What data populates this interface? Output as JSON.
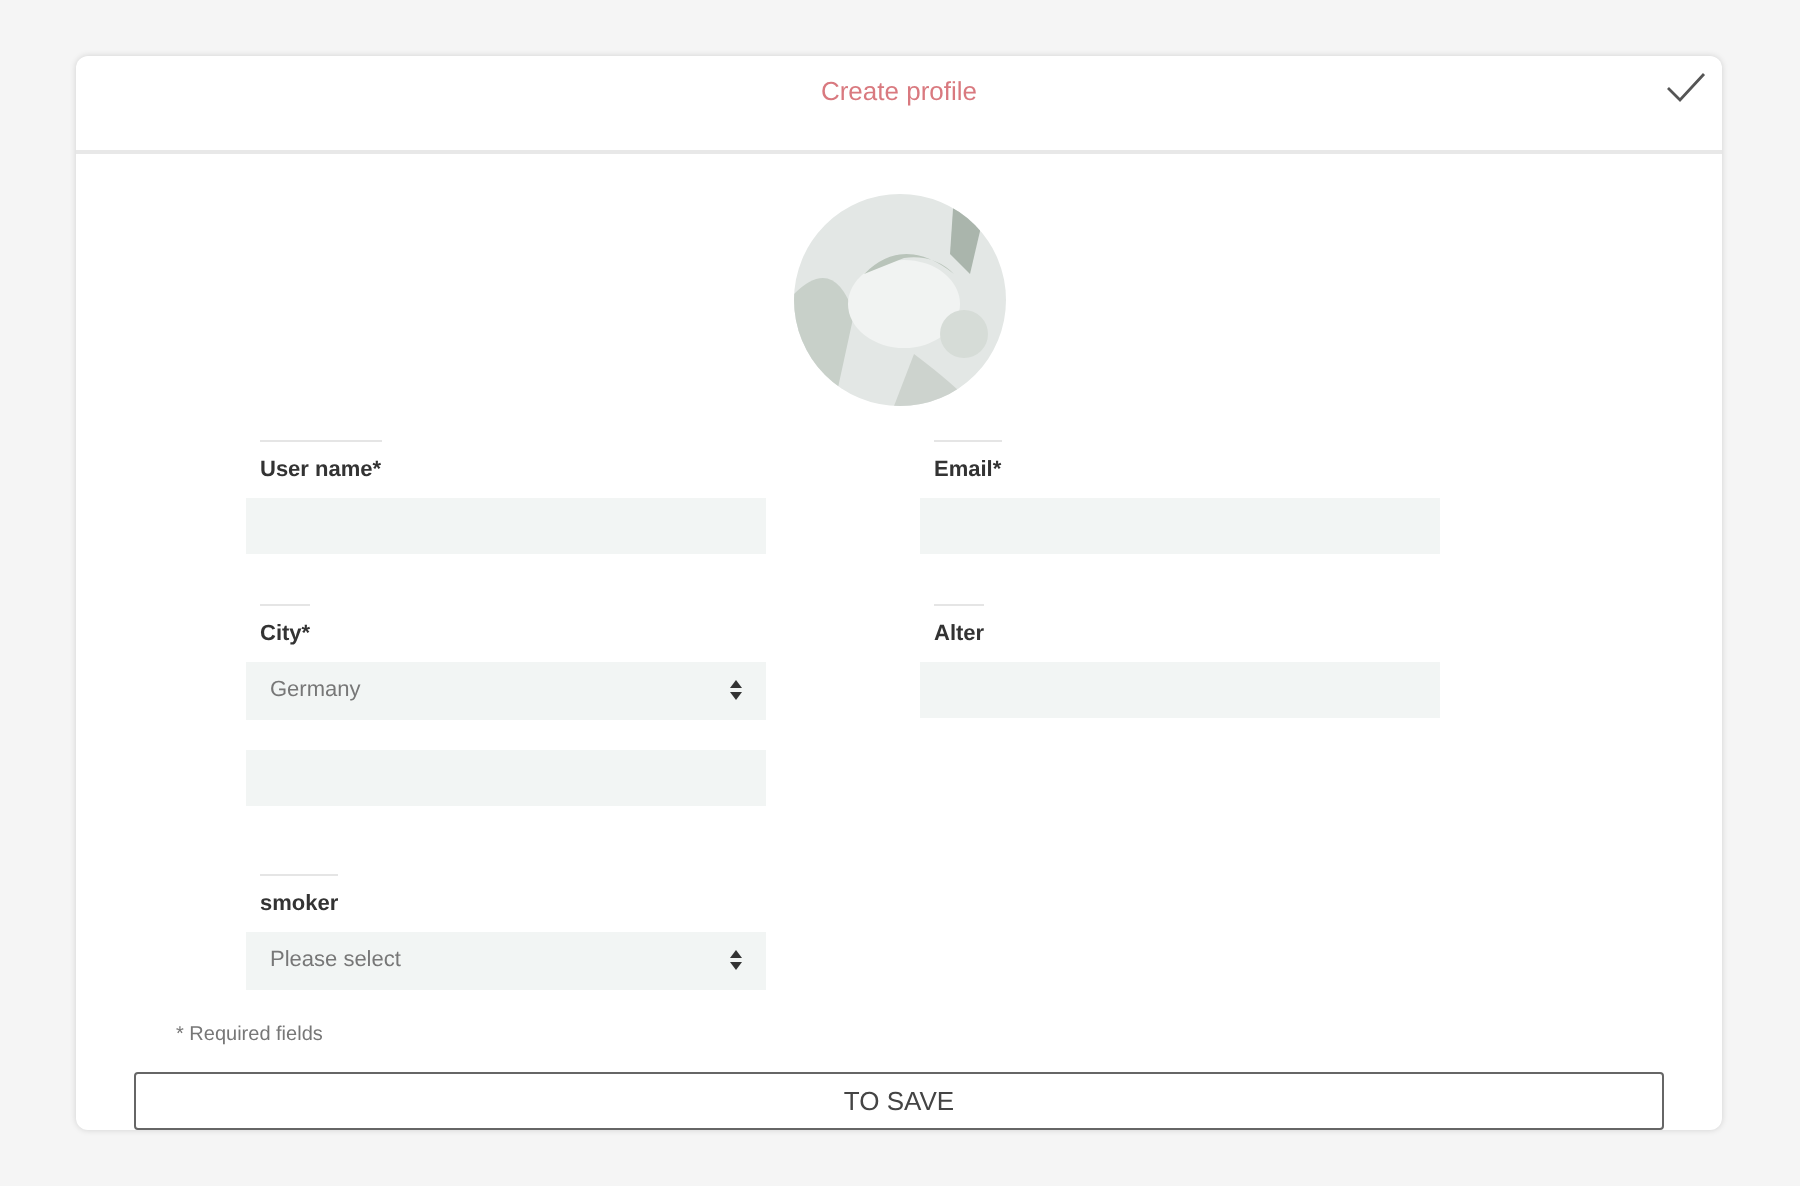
{
  "header": {
    "title": "Create profile"
  },
  "columns": [
    {
      "fields": [
        {
          "kind": "text",
          "label": "User name*"
        },
        {
          "kind": "select",
          "label": "City*",
          "value": "Germany"
        },
        {
          "kind": "text"
        },
        {
          "kind": "select",
          "label": "smoker",
          "value": "Please select"
        }
      ]
    },
    {
      "fields": [
        {
          "kind": "text",
          "label": "Email*"
        },
        {
          "kind": "text",
          "label": "Alter"
        }
      ]
    }
  ],
  "note": "* Required fields",
  "save_button": "TO SAVE"
}
